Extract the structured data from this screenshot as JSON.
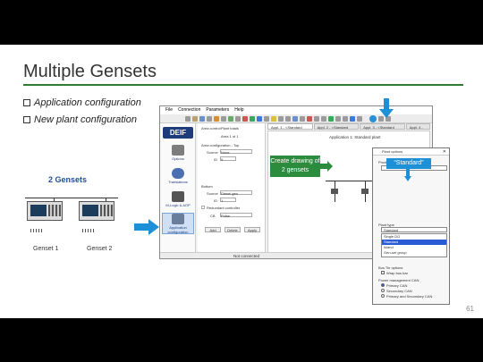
{
  "slide": {
    "title": "Multiple Gensets",
    "bullets": [
      "Application configuration",
      "New plant configuration"
    ],
    "gensets_label": "2 Gensets",
    "genset_captions": [
      "Genset 1",
      "Genset 2"
    ],
    "page_number": "61"
  },
  "app": {
    "menu": [
      "File",
      "Connection",
      "Parameters",
      "Help"
    ],
    "logo": "DEIF",
    "nav": [
      "Options",
      "Translations",
      "M-Logic & AOP",
      "Application configuration"
    ],
    "mid": {
      "tabs": [
        "Area control",
        "Plant totals"
      ],
      "area_of": "Area 1 of 1",
      "area_config": "Area configuration - Top",
      "source_label": "Source",
      "source_value": "None",
      "id_label": "ID",
      "id_value": "0",
      "bottom_label": "Bottom",
      "bottom_source_value": "Diesel gen",
      "bottom_id_value": "1",
      "redundant_label": "Redundant controller",
      "cb_label": "CB",
      "cb_value": "Pulse",
      "buttons": [
        "Add",
        "Delete",
        "Apply"
      ]
    },
    "tabs": [
      "Appl. 1 - <Standard plant>",
      "Appl. 2 - <Standard plant>",
      "Appl. 3 - <Standard plant>",
      "Appl. 4 - <S"
    ],
    "canvas_title": "Application 1: Standard plant",
    "status": "Not connected"
  },
  "callouts": {
    "create_drawing": "Create drawing of 2 gensets",
    "standard": "“Standard”"
  },
  "dialog": {
    "title": "Plant options",
    "product_label": "Product",
    "plant_type_label": "Plant type",
    "plant_type_value": "Standard",
    "plant_type_options": [
      "Single DG",
      "Standard",
      "Island",
      "Gen-set group"
    ],
    "bus_tie_label": "Bus Tie options",
    "bus_tie_option": "Wrap bus bar",
    "power_mgmt_label": "Power management CAN",
    "power_mgmt_options": [
      "Primary CAN",
      "Secondary CAN",
      "Primary and Secondary CAN"
    ],
    "can_bus_label": "CAN bus off (stand-alone application)",
    "app_emulation_label": "Application emulation",
    "app_emulation_options": [
      "Off",
      "Breaker and engine cmd. active",
      "Breaker and engine cmd. inactive"
    ],
    "buttons": [
      "OK",
      "Cancel"
    ]
  },
  "colors": {
    "title_rule": "#2e7d32",
    "arrow": "#1e90d8",
    "callout_green": "#2a8c3c",
    "logo": "#1f3c7a"
  }
}
